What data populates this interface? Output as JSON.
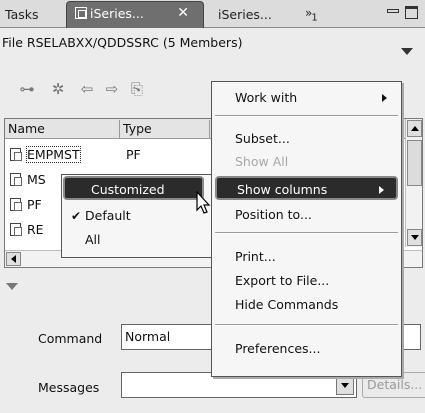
{
  "tabs": [
    {
      "label": "Tasks"
    },
    {
      "label": "iSeries...",
      "active": true
    },
    {
      "label": "iSeries..."
    }
  ],
  "tab_overflow": {
    "symbol": "»",
    "count": "1"
  },
  "view": {
    "title": "File RSELABXX/QDDSSRC (5 Members)"
  },
  "toolbar": {
    "icons": [
      "filter-icon",
      "refresh-icon",
      "back-icon",
      "forward-icon",
      "up-folder-icon"
    ]
  },
  "table": {
    "columns": [
      "Name",
      "Type"
    ],
    "rows": [
      {
        "name": "EMPMST",
        "type": "PF"
      },
      {
        "name": "MS",
        "type": ""
      },
      {
        "name": "PF",
        "type": ""
      },
      {
        "name": "RE",
        "type": ""
      }
    ]
  },
  "command": {
    "label": "Command",
    "value": "Normal"
  },
  "messages": {
    "label": "Messages",
    "value": "",
    "details_label": "Details..."
  },
  "context_menu": {
    "items": [
      {
        "label": "Work with",
        "submenu": true
      },
      {
        "label": "Subset..."
      },
      {
        "label": "Show All",
        "disabled": true
      },
      {
        "label": "Show columns",
        "submenu": true,
        "highlighted": true
      },
      {
        "label": "Position to..."
      },
      {
        "label": "Print..."
      },
      {
        "label": "Export to File..."
      },
      {
        "label": "Hide Commands"
      },
      {
        "label": "Preferences..."
      }
    ]
  },
  "submenu": {
    "items": [
      {
        "label": "Customized",
        "highlighted": true
      },
      {
        "label": "Default",
        "checked": true
      },
      {
        "label": "All"
      }
    ],
    "check_mark": "✔"
  },
  "colors": {
    "highlight": "#2b2b2b",
    "active_tab": "#6f6f6f",
    "disabled": "#a8a8a8"
  }
}
